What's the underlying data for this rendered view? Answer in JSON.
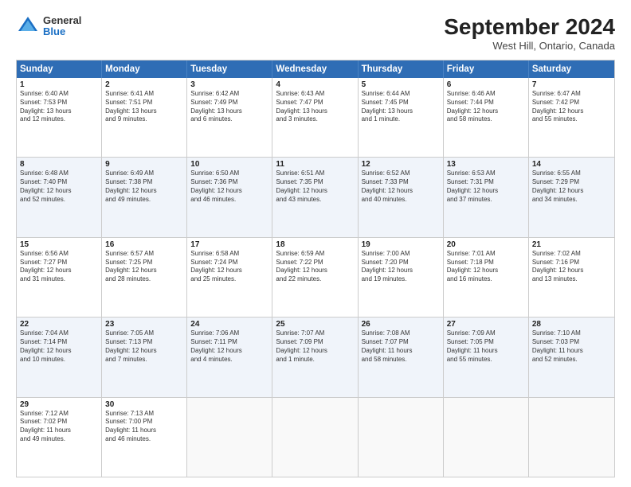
{
  "header": {
    "logo": {
      "general": "General",
      "blue": "Blue"
    },
    "title": "September 2024",
    "location": "West Hill, Ontario, Canada"
  },
  "weekdays": [
    "Sunday",
    "Monday",
    "Tuesday",
    "Wednesday",
    "Thursday",
    "Friday",
    "Saturday"
  ],
  "rows": [
    [
      {
        "day": "1",
        "lines": [
          "Sunrise: 6:40 AM",
          "Sunset: 7:53 PM",
          "Daylight: 13 hours",
          "and 12 minutes."
        ]
      },
      {
        "day": "2",
        "lines": [
          "Sunrise: 6:41 AM",
          "Sunset: 7:51 PM",
          "Daylight: 13 hours",
          "and 9 minutes."
        ]
      },
      {
        "day": "3",
        "lines": [
          "Sunrise: 6:42 AM",
          "Sunset: 7:49 PM",
          "Daylight: 13 hours",
          "and 6 minutes."
        ]
      },
      {
        "day": "4",
        "lines": [
          "Sunrise: 6:43 AM",
          "Sunset: 7:47 PM",
          "Daylight: 13 hours",
          "and 3 minutes."
        ]
      },
      {
        "day": "5",
        "lines": [
          "Sunrise: 6:44 AM",
          "Sunset: 7:45 PM",
          "Daylight: 13 hours",
          "and 1 minute."
        ]
      },
      {
        "day": "6",
        "lines": [
          "Sunrise: 6:46 AM",
          "Sunset: 7:44 PM",
          "Daylight: 12 hours",
          "and 58 minutes."
        ]
      },
      {
        "day": "7",
        "lines": [
          "Sunrise: 6:47 AM",
          "Sunset: 7:42 PM",
          "Daylight: 12 hours",
          "and 55 minutes."
        ]
      }
    ],
    [
      {
        "day": "8",
        "lines": [
          "Sunrise: 6:48 AM",
          "Sunset: 7:40 PM",
          "Daylight: 12 hours",
          "and 52 minutes."
        ]
      },
      {
        "day": "9",
        "lines": [
          "Sunrise: 6:49 AM",
          "Sunset: 7:38 PM",
          "Daylight: 12 hours",
          "and 49 minutes."
        ]
      },
      {
        "day": "10",
        "lines": [
          "Sunrise: 6:50 AM",
          "Sunset: 7:36 PM",
          "Daylight: 12 hours",
          "and 46 minutes."
        ]
      },
      {
        "day": "11",
        "lines": [
          "Sunrise: 6:51 AM",
          "Sunset: 7:35 PM",
          "Daylight: 12 hours",
          "and 43 minutes."
        ]
      },
      {
        "day": "12",
        "lines": [
          "Sunrise: 6:52 AM",
          "Sunset: 7:33 PM",
          "Daylight: 12 hours",
          "and 40 minutes."
        ]
      },
      {
        "day": "13",
        "lines": [
          "Sunrise: 6:53 AM",
          "Sunset: 7:31 PM",
          "Daylight: 12 hours",
          "and 37 minutes."
        ]
      },
      {
        "day": "14",
        "lines": [
          "Sunrise: 6:55 AM",
          "Sunset: 7:29 PM",
          "Daylight: 12 hours",
          "and 34 minutes."
        ]
      }
    ],
    [
      {
        "day": "15",
        "lines": [
          "Sunrise: 6:56 AM",
          "Sunset: 7:27 PM",
          "Daylight: 12 hours",
          "and 31 minutes."
        ]
      },
      {
        "day": "16",
        "lines": [
          "Sunrise: 6:57 AM",
          "Sunset: 7:25 PM",
          "Daylight: 12 hours",
          "and 28 minutes."
        ]
      },
      {
        "day": "17",
        "lines": [
          "Sunrise: 6:58 AM",
          "Sunset: 7:24 PM",
          "Daylight: 12 hours",
          "and 25 minutes."
        ]
      },
      {
        "day": "18",
        "lines": [
          "Sunrise: 6:59 AM",
          "Sunset: 7:22 PM",
          "Daylight: 12 hours",
          "and 22 minutes."
        ]
      },
      {
        "day": "19",
        "lines": [
          "Sunrise: 7:00 AM",
          "Sunset: 7:20 PM",
          "Daylight: 12 hours",
          "and 19 minutes."
        ]
      },
      {
        "day": "20",
        "lines": [
          "Sunrise: 7:01 AM",
          "Sunset: 7:18 PM",
          "Daylight: 12 hours",
          "and 16 minutes."
        ]
      },
      {
        "day": "21",
        "lines": [
          "Sunrise: 7:02 AM",
          "Sunset: 7:16 PM",
          "Daylight: 12 hours",
          "and 13 minutes."
        ]
      }
    ],
    [
      {
        "day": "22",
        "lines": [
          "Sunrise: 7:04 AM",
          "Sunset: 7:14 PM",
          "Daylight: 12 hours",
          "and 10 minutes."
        ]
      },
      {
        "day": "23",
        "lines": [
          "Sunrise: 7:05 AM",
          "Sunset: 7:13 PM",
          "Daylight: 12 hours",
          "and 7 minutes."
        ]
      },
      {
        "day": "24",
        "lines": [
          "Sunrise: 7:06 AM",
          "Sunset: 7:11 PM",
          "Daylight: 12 hours",
          "and 4 minutes."
        ]
      },
      {
        "day": "25",
        "lines": [
          "Sunrise: 7:07 AM",
          "Sunset: 7:09 PM",
          "Daylight: 12 hours",
          "and 1 minute."
        ]
      },
      {
        "day": "26",
        "lines": [
          "Sunrise: 7:08 AM",
          "Sunset: 7:07 PM",
          "Daylight: 11 hours",
          "and 58 minutes."
        ]
      },
      {
        "day": "27",
        "lines": [
          "Sunrise: 7:09 AM",
          "Sunset: 7:05 PM",
          "Daylight: 11 hours",
          "and 55 minutes."
        ]
      },
      {
        "day": "28",
        "lines": [
          "Sunrise: 7:10 AM",
          "Sunset: 7:03 PM",
          "Daylight: 11 hours",
          "and 52 minutes."
        ]
      }
    ],
    [
      {
        "day": "29",
        "lines": [
          "Sunrise: 7:12 AM",
          "Sunset: 7:02 PM",
          "Daylight: 11 hours",
          "and 49 minutes."
        ]
      },
      {
        "day": "30",
        "lines": [
          "Sunrise: 7:13 AM",
          "Sunset: 7:00 PM",
          "Daylight: 11 hours",
          "and 46 minutes."
        ]
      },
      {
        "day": "",
        "lines": []
      },
      {
        "day": "",
        "lines": []
      },
      {
        "day": "",
        "lines": []
      },
      {
        "day": "",
        "lines": []
      },
      {
        "day": "",
        "lines": []
      }
    ]
  ]
}
